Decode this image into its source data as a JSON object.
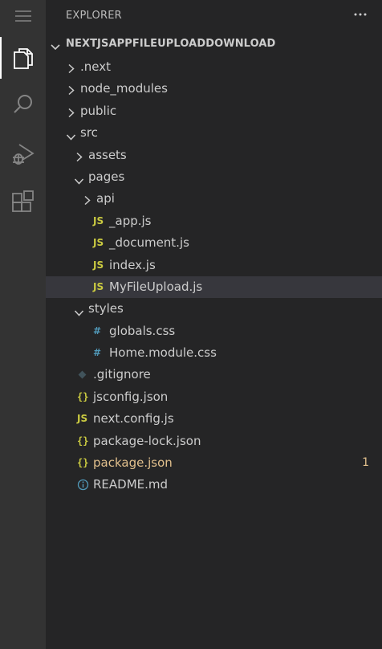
{
  "activity_bar": {
    "items": [
      {
        "name": "menu",
        "icon": "hamburger-menu-icon"
      },
      {
        "name": "explorer",
        "icon": "files-icon",
        "active": true
      },
      {
        "name": "search",
        "icon": "search-icon"
      },
      {
        "name": "run-debug",
        "icon": "run-debug-icon"
      },
      {
        "name": "extensions",
        "icon": "extensions-icon"
      }
    ]
  },
  "explorer": {
    "title": "EXPLORER",
    "more_icon": "ellipsis-icon",
    "section_title": "NEXTJSAPPFILEUPLOADDOWNLOAD",
    "tree": [
      {
        "label": ".next",
        "type": "folder",
        "expanded": false,
        "depth": 0
      },
      {
        "label": "node_modules",
        "type": "folder",
        "expanded": false,
        "depth": 0
      },
      {
        "label": "public",
        "type": "folder",
        "expanded": false,
        "depth": 0
      },
      {
        "label": "src",
        "type": "folder",
        "expanded": true,
        "depth": 0
      },
      {
        "label": "assets",
        "type": "folder",
        "expanded": false,
        "depth": 1
      },
      {
        "label": "pages",
        "type": "folder",
        "expanded": true,
        "depth": 1
      },
      {
        "label": "api",
        "type": "folder",
        "expanded": false,
        "depth": 2
      },
      {
        "label": "_app.js",
        "type": "js",
        "icon_text": "JS",
        "depth": 2
      },
      {
        "label": "_document.js",
        "type": "js",
        "icon_text": "JS",
        "depth": 2
      },
      {
        "label": "index.js",
        "type": "js",
        "icon_text": "JS",
        "depth": 2
      },
      {
        "label": "MyFileUpload.js",
        "type": "js",
        "icon_text": "JS",
        "depth": 2,
        "selected": true
      },
      {
        "label": "styles",
        "type": "folder",
        "expanded": true,
        "depth": 1
      },
      {
        "label": "globals.css",
        "type": "css",
        "icon_text": "#",
        "depth": 2
      },
      {
        "label": "Home.module.css",
        "type": "css",
        "icon_text": "#",
        "depth": 2
      },
      {
        "label": ".gitignore",
        "type": "git",
        "icon_text": "◆",
        "depth": 0
      },
      {
        "label": "jsconfig.json",
        "type": "json",
        "icon_text": "{}",
        "depth": 0
      },
      {
        "label": "next.config.js",
        "type": "js",
        "icon_text": "JS",
        "depth": 0
      },
      {
        "label": "package-lock.json",
        "type": "json",
        "icon_text": "{}",
        "depth": 0
      },
      {
        "label": "package.json",
        "type": "json",
        "icon_text": "{}",
        "depth": 0,
        "modified": true,
        "badge": "1"
      },
      {
        "label": "README.md",
        "type": "info",
        "icon_text": "ⓘ",
        "depth": 0
      }
    ]
  },
  "colors": {
    "activity_bg": "#333333",
    "sidebar_bg": "#252526",
    "selected_row": "#37373d",
    "js_yellow": "#cbcb41",
    "css_blue": "#519aba",
    "modified": "#e2c08d"
  }
}
